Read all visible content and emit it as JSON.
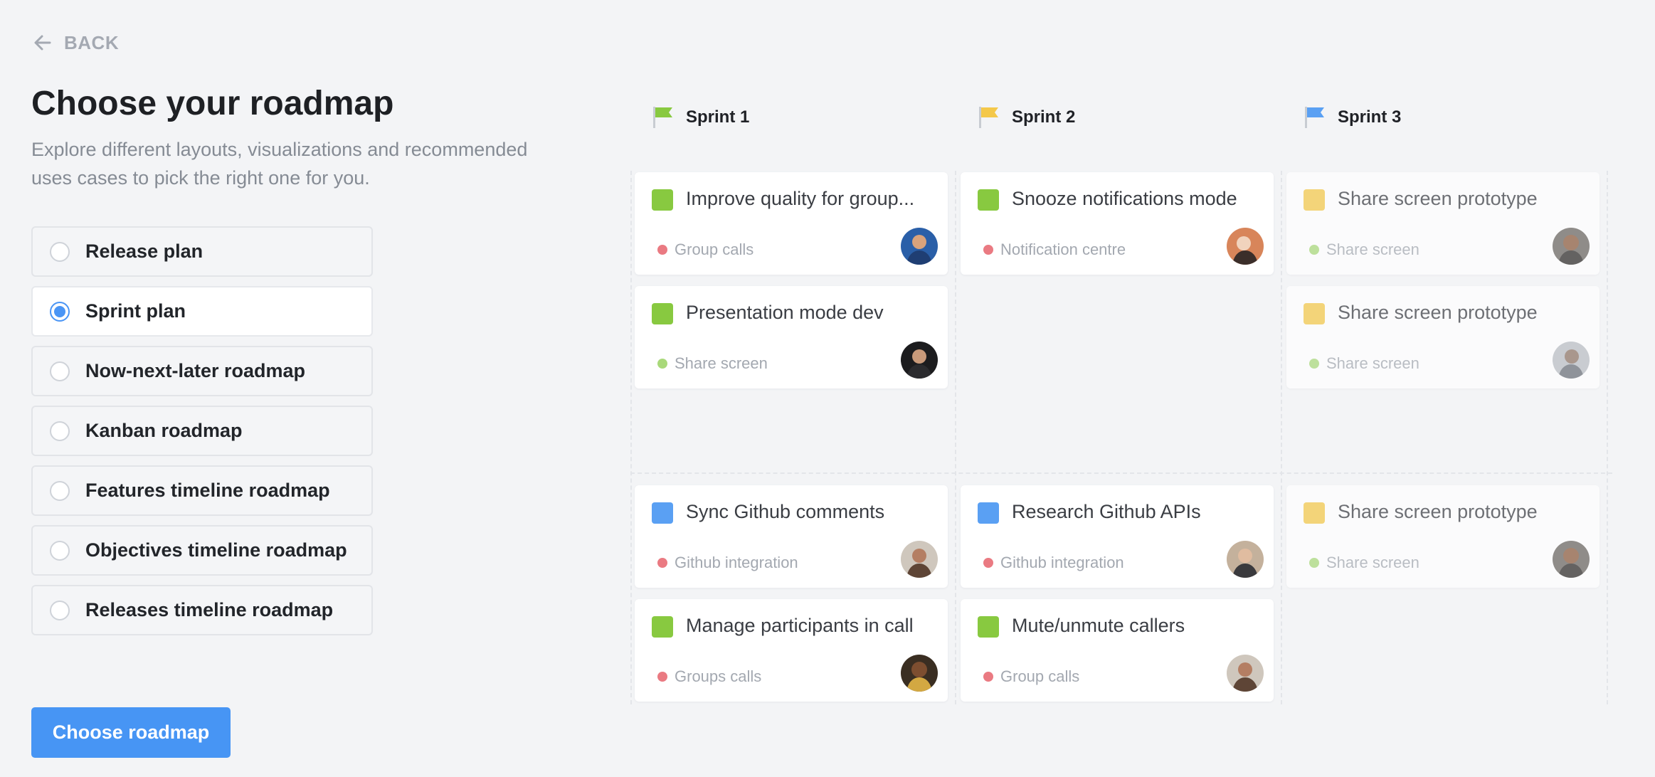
{
  "back": {
    "label": "BACK"
  },
  "title": "Choose your roadmap",
  "subtitle": "Explore different layouts, visualizations and recommended uses cases to pick the right one for you.",
  "options": [
    {
      "label": "Release plan",
      "selected": false
    },
    {
      "label": "Sprint plan",
      "selected": true
    },
    {
      "label": "Now-next-later roadmap",
      "selected": false
    },
    {
      "label": "Kanban roadmap",
      "selected": false
    },
    {
      "label": "Features timeline roadmap",
      "selected": false
    },
    {
      "label": "Objectives timeline roadmap",
      "selected": false
    },
    {
      "label": "Releases timeline roadmap",
      "selected": false
    }
  ],
  "cta": {
    "label": "Choose roadmap"
  },
  "colors": {
    "accent": "#4795f4",
    "green": "#88c940",
    "yellow": "#f4c84a",
    "blue": "#5aa0f3",
    "red_dot": "#ea7a82",
    "green_dot": "#a9d97a"
  },
  "sprints": [
    {
      "name": "Sprint 1",
      "flag_color": "#88c940"
    },
    {
      "name": "Sprint 2",
      "flag_color": "#f4c84a"
    },
    {
      "name": "Sprint 3",
      "flag_color": "#5aa0f3"
    }
  ],
  "cards": [
    {
      "title": "Improve quality for group...",
      "tag": "Group calls",
      "square": "green",
      "dot": "red",
      "avatar": "avatar-man-blue",
      "faded": false
    },
    {
      "title": "Snooze notifications mode",
      "tag": "Notification centre",
      "square": "green",
      "dot": "red",
      "avatar": "avatar-man-orange",
      "faded": false
    },
    {
      "title": "Share screen prototype",
      "tag": "Share screen",
      "square": "yellow",
      "dot": "green",
      "avatar": "avatar-woman-dark",
      "faded": true
    },
    {
      "title": "Presentation mode dev",
      "tag": "Share screen",
      "square": "green",
      "dot": "green",
      "avatar": "avatar-man-dark",
      "faded": false
    },
    {
      "title": "Share screen prototype",
      "tag": "Share screen",
      "square": "yellow",
      "dot": "green",
      "avatar": "avatar-woman-light",
      "faded": true
    },
    {
      "title": "Sync Github comments",
      "tag": "Github integration",
      "square": "blue",
      "dot": "red",
      "avatar": "avatar-woman-brown",
      "faded": false
    },
    {
      "title": "Research Github APIs",
      "tag": "Github integration",
      "square": "blue",
      "dot": "red",
      "avatar": "avatar-man-beige",
      "faded": false
    },
    {
      "title": "Share screen prototype",
      "tag": "Share screen",
      "square": "yellow",
      "dot": "green",
      "avatar": "avatar-woman-dark",
      "faded": true
    },
    {
      "title": "Manage participants in call",
      "tag": "Groups calls",
      "square": "green",
      "dot": "red",
      "avatar": "avatar-woman-dark",
      "faded": false
    },
    {
      "title": "Mute/unmute callers",
      "tag": "Group calls",
      "square": "green",
      "dot": "red",
      "avatar": "avatar-woman-brown",
      "faded": false
    }
  ]
}
